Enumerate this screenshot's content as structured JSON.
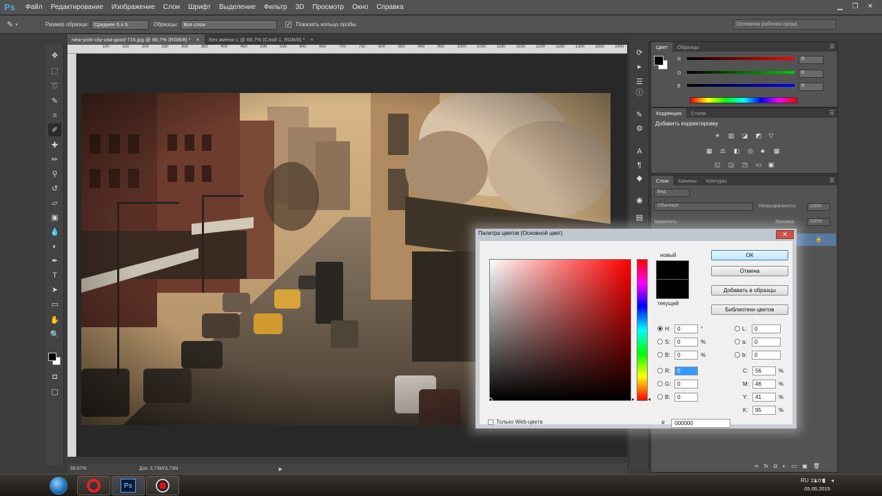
{
  "menubar": {
    "logo": "Ps",
    "items": [
      "Файл",
      "Редактирование",
      "Изображение",
      "Слои",
      "Шрифт",
      "Выделение",
      "Фильтр",
      "3D",
      "Просмотр",
      "Окно",
      "Справка"
    ]
  },
  "options_bar": {
    "sample_size_label": "Размер образца:",
    "sample_size_value": "Среднее 5 х 5",
    "samples_label": "Образцы:",
    "samples_value": "Все слои",
    "show_ring_label": "Показать кольцо пробы",
    "workspace": "Основная рабочая среда"
  },
  "tabs": [
    {
      "label": "new-york-city-usa-good-715.jpg @ 66,7% (RGB/8) *",
      "close": "×"
    },
    {
      "label": "Без имени-1 @ 66,7% (Слой 1, RGB/8) *",
      "close": "×"
    }
  ],
  "ruler_h": [
    "",
    "100",
    "150",
    "200",
    "250",
    "300",
    "350",
    "400",
    "450",
    "500",
    "550",
    "600",
    "650",
    "700",
    "750",
    "800",
    "850",
    "900",
    "950",
    "1000",
    "1050",
    "1100",
    "1150",
    "1200",
    "1250",
    "1300",
    "1350",
    "1400"
  ],
  "status": {
    "zoom": "66,67%",
    "doc": "Док: 3,73М/3,73М"
  },
  "color_panel": {
    "tabs": [
      "Цвет",
      "Образцы"
    ],
    "r_label": "R",
    "g_label": "G",
    "b_label": "B",
    "r_value": "0",
    "g_value": "0",
    "b_value": "0"
  },
  "adjustments_panel": {
    "tabs": [
      "Коррекция",
      "Стили"
    ],
    "title": "Добавить корректировку"
  },
  "layers_panel": {
    "tabs": [
      "Слои",
      "Каналы",
      "Контуры"
    ],
    "kind": "Вид",
    "blend": "Обычные",
    "opacity_label": "Непрозрачность:",
    "opacity_value": "100%",
    "fill_label": "Заливка:",
    "fill_value": "100%",
    "lock_label": "Закрепить:"
  },
  "dialog": {
    "title": "Палитра цветов (Основной цвет)",
    "new_label": "новый",
    "current_label": "текущий",
    "buttons": {
      "ok": "ОК",
      "cancel": "Отмена",
      "add_swatch": "Добавить в образцы",
      "libraries": "Библиотеки цветов"
    },
    "fields": {
      "H": {
        "label": "H:",
        "value": "0",
        "unit": "°"
      },
      "S": {
        "label": "S:",
        "value": "0",
        "unit": "%"
      },
      "B": {
        "label": "B:",
        "value": "0",
        "unit": "%"
      },
      "R": {
        "label": "R:",
        "value": "0"
      },
      "G": {
        "label": "G:",
        "value": "0"
      },
      "Bl": {
        "label": "B:",
        "value": "0"
      },
      "L": {
        "label": "L:",
        "value": "0"
      },
      "a": {
        "label": "a:",
        "value": "0"
      },
      "b": {
        "label": "b:",
        "value": "0"
      },
      "C": {
        "label": "C:",
        "value": "56",
        "unit": "%"
      },
      "M": {
        "label": "M:",
        "value": "46",
        "unit": "%"
      },
      "Y": {
        "label": "Y:",
        "value": "41",
        "unit": "%"
      },
      "K": {
        "label": "K:",
        "value": "95",
        "unit": "%"
      }
    },
    "hex_label": "#",
    "hex_value": "000000",
    "web_only_label": "Только Web-цвета"
  },
  "taskbar": {
    "lang": "RU",
    "time": "22:07",
    "date": "05.05.2015"
  },
  "colors": {
    "accent_blue": "#4ea6e6",
    "panel_bg": "#535353",
    "ok_border": "#3c7fb1"
  }
}
